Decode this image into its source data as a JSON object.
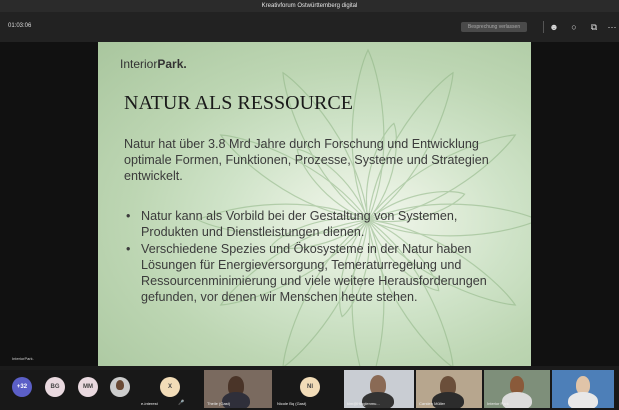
{
  "window": {
    "title": "Kreativforum Ostwürttemberg digital"
  },
  "toolbar": {
    "timer": "01:03:06",
    "leave_label": "Besprechung verlassen",
    "icons": [
      "participants-icon",
      "chat-icon",
      "share-icon",
      "more-icon"
    ]
  },
  "slide": {
    "logo_light": "Interior",
    "logo_bold": "Park.",
    "heading": "NATUR ALS RESSOURCE",
    "intro": "Natur hat über 3.8 Mrd Jahre durch Forschung und Entwicklung optimale Formen, Funktionen, Prozesse, Systeme und Strategien entwickelt.",
    "bullets": [
      "Natur kann als Vorbild bei der Gestaltung von Systemen, Produkten und Dienstleistungen dienen.",
      "Verschiedene Spezies und Ökosysteme in der Natur haben Lösungen für Energieversorgung, Temeraturregelung und Ressourcenminimierung und viele weitere Herausforderungen gefunden, vor denen wir Menschen heute stehen."
    ]
  },
  "stage": {
    "mini_logo": "InteriorPark."
  },
  "participants": {
    "overflow_count": "+32",
    "avatars": [
      {
        "initials": "BG",
        "color": "#e9d9df"
      },
      {
        "initials": "MM",
        "color": "#e9d9df"
      },
      {
        "initials": "X",
        "color": "#f2dcb8"
      },
      {
        "initials": "NI",
        "color": "#f2dcb8"
      }
    ],
    "tiles": [
      {
        "name": "e-interest"
      },
      {
        "name": "Theile (Gast)"
      },
      {
        "name": "Nicole Bq (Gast)"
      },
      {
        "name": "kim@Hinglenmu..."
      },
      {
        "name": "Carsten Müller"
      },
      {
        "name": "Interior Park"
      }
    ]
  },
  "colors": {
    "accent": "#5b5fc7",
    "overflow_badge": "#5b5fc7"
  }
}
